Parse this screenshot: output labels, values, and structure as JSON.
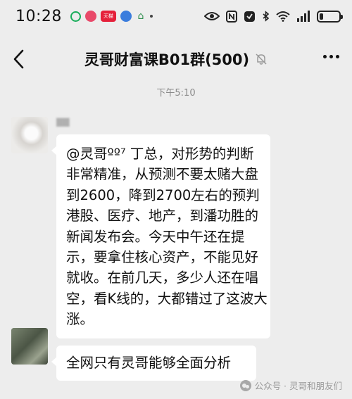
{
  "status_bar": {
    "time": "10:28",
    "notification_icons": [
      "wechat-ring-icon",
      "app-red-icon",
      "tmall-icon",
      "browser-blue-icon",
      "house-icon",
      "dot-icon"
    ],
    "tmall_label": "天猫",
    "battery_level": 0.2,
    "right_icons": [
      "eye-icon",
      "nfc-icon",
      "alarm-icon",
      "bluetooth-icon",
      "wifi-icon",
      "signal-icon",
      "battery-icon"
    ]
  },
  "header": {
    "title": "灵哥财富课B01群(500)"
  },
  "chat": {
    "timestamp": "下午5:10",
    "messages": [
      {
        "lines": [
          "@灵哥ºº⁷ 丁总，对形势的判断",
          "非常精准，从预测不要太赌大盘",
          "到2600，降到2700左右的预判",
          "港股、医疗、地产，到潘功胜的",
          "新闻发布会。今天中午还在提",
          "示，要拿住核心资产，不能见好",
          "就收。在前几天，多少人还在唱",
          "空，看K线的，大都错过了这波大",
          "涨。"
        ]
      },
      {
        "lines": [
          "全网只有灵哥能够全面分析"
        ]
      }
    ]
  },
  "watermark": {
    "text": "公众号 · 灵哥和朋友们"
  },
  "colors": {
    "background": "#ededed",
    "bubble": "#ffffff",
    "timestamp": "#8a8a8a"
  }
}
